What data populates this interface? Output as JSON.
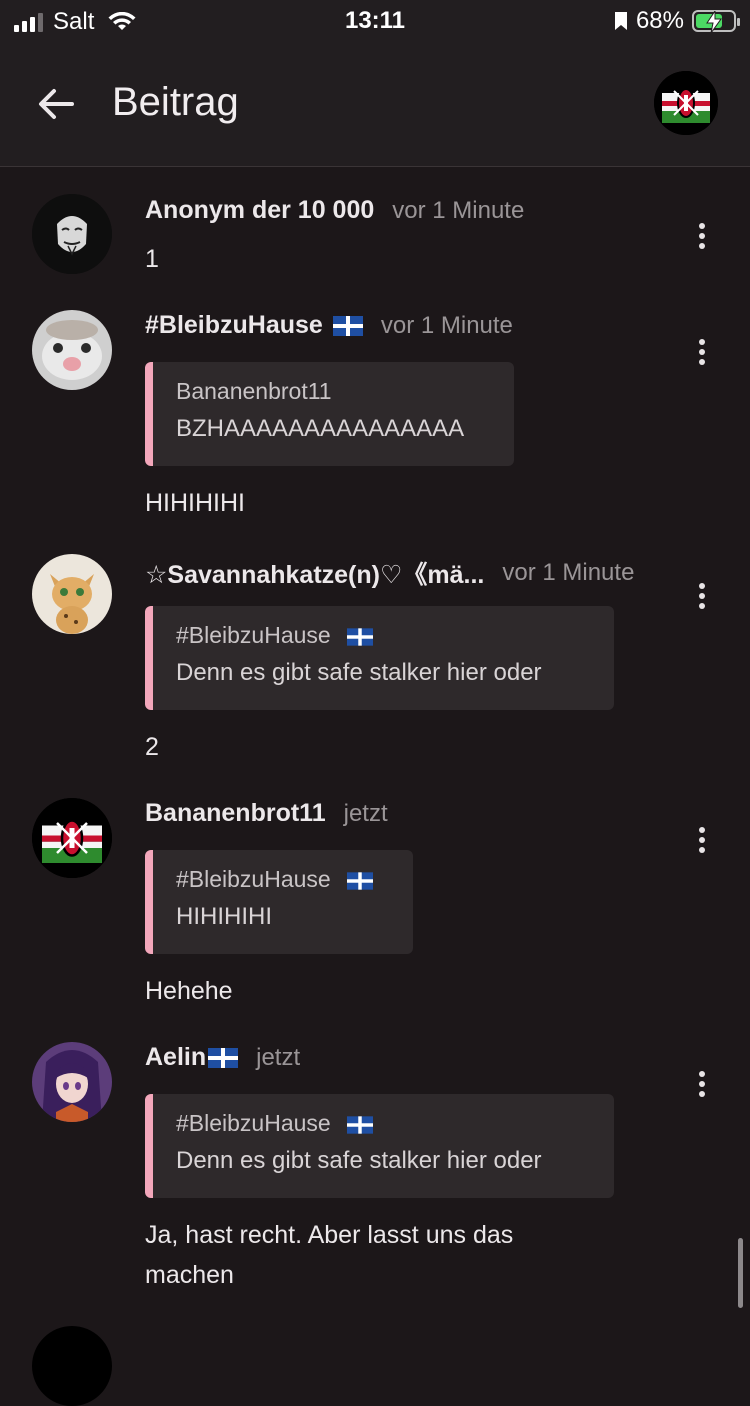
{
  "status": {
    "carrier": "Salt",
    "time": "13:11",
    "battery": "68%",
    "battery_level": 0.68
  },
  "header": {
    "title": "Beitrag",
    "back_icon": "arrow-left-icon",
    "avatar_icon": "kenya-flag-avatar"
  },
  "posts": [
    {
      "author": "Anonym der 10 000",
      "time": "vor 1 Minute",
      "text": "1"
    },
    {
      "author": "#BleibzuHause",
      "time": "vor 1 Minute",
      "has_flag": true,
      "quote": {
        "author": "Bananenbrot11",
        "text": "BZHAAAAAAAAAAAAAAA"
      },
      "text": "HIHIHIHI"
    },
    {
      "author": "☆Savannahkatze(n)♡《mä...",
      "time": "vor 1 Minute",
      "quote": {
        "author": "#BleibzuHause",
        "text": "Denn es gibt safe stalker hier oder"
      },
      "text": "2"
    },
    {
      "author": "Bananenbrot11",
      "time": "jetzt",
      "quote": {
        "author": "#BleibzuHause",
        "text": "HIHIHIHI"
      },
      "text": "Hehehe"
    },
    {
      "author": "Aelin",
      "time": "jetzt",
      "has_flag": true,
      "quote": {
        "author": "#BleibzuHause",
        "text": "Denn es gibt safe stalker hier oder"
      },
      "text": "Ja, hast recht. Aber lasst uns das machen"
    }
  ],
  "colors": {
    "background": "#1c1719",
    "header": "#221e20",
    "quote_bg": "#2e292b",
    "quote_accent": "#f3a7bb",
    "muted_text": "#9a9597"
  }
}
